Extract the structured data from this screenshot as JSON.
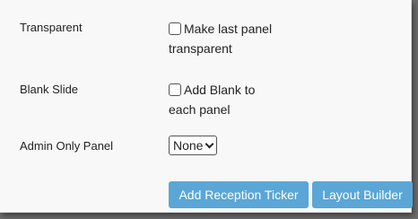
{
  "rows": [
    {
      "label": "Transparent",
      "checkbox_line1": "Make last panel",
      "checkbox_line2": "transparent",
      "checked": false
    },
    {
      "label": "Blank Slide",
      "checkbox_line1": "Add Blank to",
      "checkbox_line2": "each panel",
      "checked": false
    }
  ],
  "admin": {
    "label": "Admin Only Panel",
    "selected": "None"
  },
  "buttons": {
    "add_ticker": "Add Reception Ticker",
    "layout_builder": "Layout Builder"
  },
  "colors": {
    "button_bg": "#5aa6d6",
    "panel_bg": "#f8f8f8"
  }
}
